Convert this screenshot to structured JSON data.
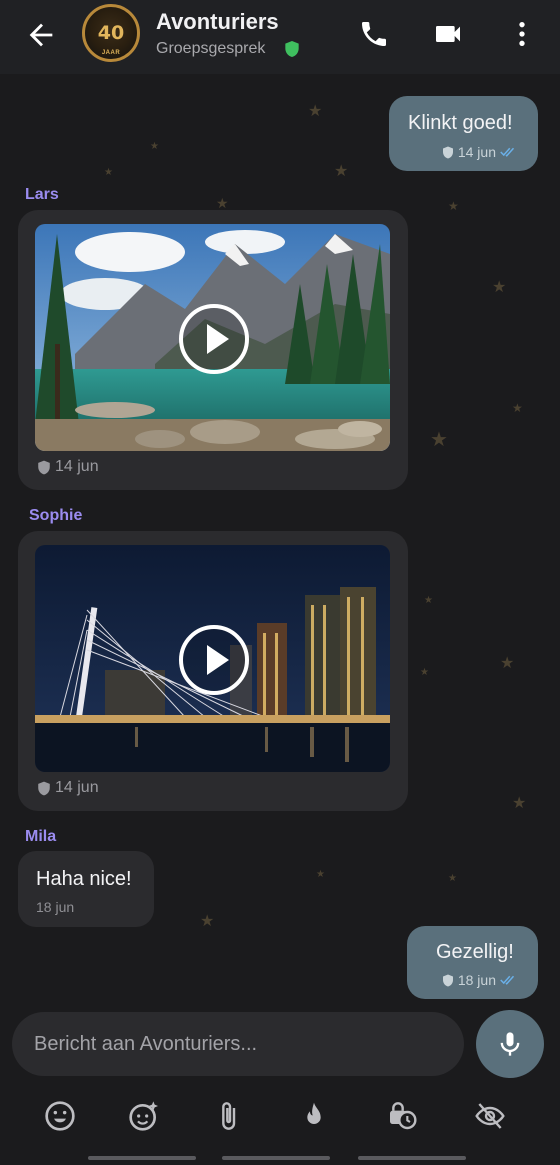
{
  "header": {
    "title": "Avonturiers",
    "subtitle": "Groepsgesprek",
    "avatar_number": "40",
    "avatar_caption": "JAAR"
  },
  "messages": [
    {
      "type": "text",
      "direction": "outgoing",
      "text": "Klinkt goed!",
      "date": "14 jun",
      "status": "read"
    },
    {
      "type": "video",
      "direction": "incoming",
      "sender": "Lars",
      "date": "14 jun",
      "thumbnail": "mountain-lake"
    },
    {
      "type": "video",
      "direction": "incoming",
      "sender": "Sophie",
      "date": "14 jun",
      "thumbnail": "city-bridge-night"
    },
    {
      "type": "text",
      "direction": "incoming",
      "sender": "Mila",
      "text": "Haha nice!",
      "date": "18 jun"
    },
    {
      "type": "text",
      "direction": "outgoing",
      "text": "Gezellig!",
      "date": "18 jun",
      "status": "read"
    }
  ],
  "composer": {
    "placeholder": "Bericht aan Avonturiers...",
    "value": ""
  },
  "toolbar_icons": [
    "emoji-icon",
    "sticker-icon",
    "attach-icon",
    "flame-icon",
    "timer-lock-icon",
    "eye-off-icon"
  ],
  "colors": {
    "background": "#1b1b1d",
    "outgoing_bubble": "#5a707c",
    "incoming_bubble": "#2b2b2e",
    "sender_name": "#9b8cf0",
    "verified": "#3fbf5f",
    "read_check": "#6ab0e8"
  }
}
